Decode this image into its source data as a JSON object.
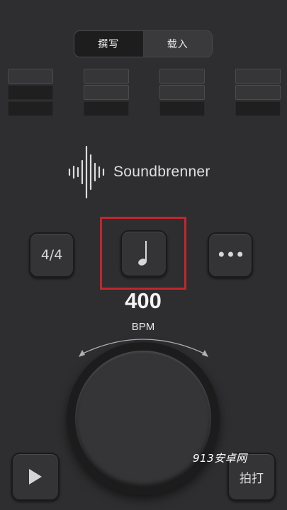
{
  "segmented": {
    "compose_label": "撰写",
    "load_label": "载入"
  },
  "logo": {
    "text": "Soundbrenner"
  },
  "buttons": {
    "time_signature": "4/4",
    "note_icon": "quarter-note-icon",
    "more_label": "•••",
    "tap_label": "拍打"
  },
  "tempo": {
    "value": "400",
    "unit": "BPM"
  },
  "beats": [
    {
      "levels": [
        "off",
        "on",
        "on"
      ]
    },
    {
      "levels": [
        "off",
        "off",
        "on"
      ]
    },
    {
      "levels": [
        "off",
        "off",
        "on"
      ]
    },
    {
      "levels": [
        "off",
        "off",
        "on"
      ]
    }
  ],
  "watermark": "913安卓网",
  "colors": {
    "background": "#2e2e30",
    "highlight": "#c1272d"
  }
}
